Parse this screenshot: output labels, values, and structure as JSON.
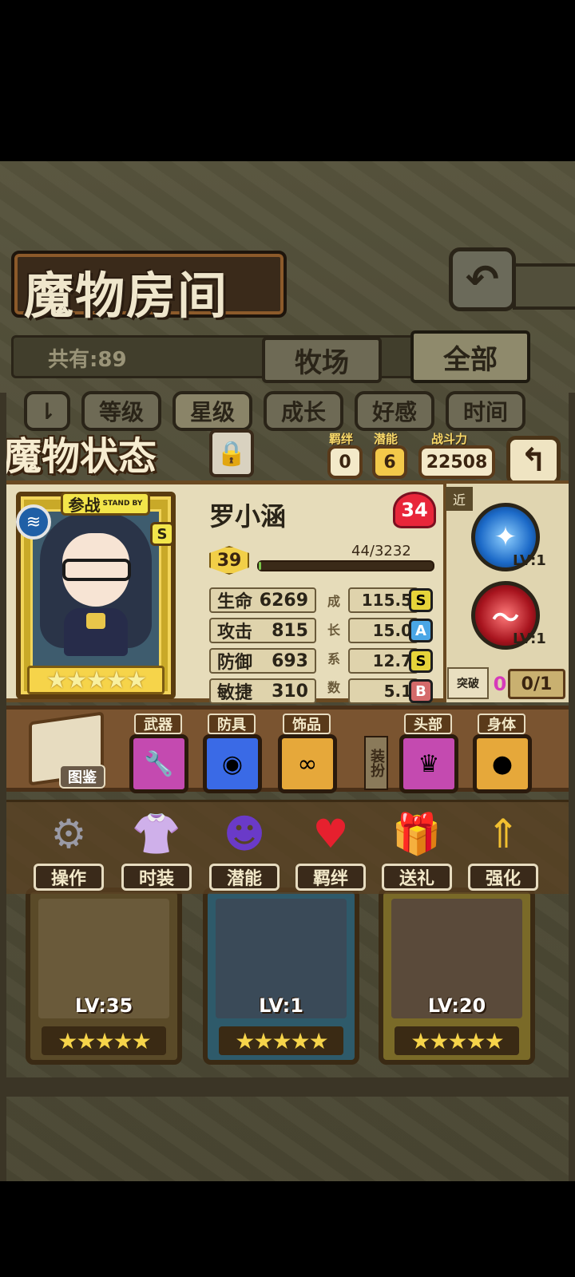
{
  "room": {
    "title": "魔物房间",
    "count_label": "共有:89",
    "back_icon": "back-arrow-icon",
    "tabs": [
      {
        "label": "牧场"
      },
      {
        "label": "全部"
      }
    ],
    "sort": [
      {
        "label": "等级"
      },
      {
        "label": "星级"
      },
      {
        "label": "成长"
      },
      {
        "label": "好感"
      },
      {
        "label": "时间"
      }
    ]
  },
  "status": {
    "title": "魔物状态",
    "bond_label": "羁绊",
    "bond_value": "0",
    "potential_label": "潜能",
    "potential_value": "6",
    "power_label": "战斗力",
    "power_value": "22508",
    "monster": {
      "badge": "参战",
      "badge_sub": "STAND BY",
      "rank": "S",
      "name": "罗小涵",
      "affinity": "34",
      "level": "39",
      "exp": "44/3232",
      "exp_fraction": 0.014,
      "star_count": 5
    },
    "stats": [
      {
        "label": "生命",
        "value": "6269",
        "growth": "115.5",
        "grade": "S"
      },
      {
        "label": "攻击",
        "value": "815",
        "growth": "15.0",
        "grade": "A"
      },
      {
        "label": "防御",
        "value": "693",
        "growth": "12.7",
        "grade": "S"
      },
      {
        "label": "敏捷",
        "value": "310",
        "growth": "5.1",
        "grade": "B"
      }
    ],
    "growth_vertical": [
      "成",
      "长",
      "系",
      "数"
    ],
    "skills": {
      "range_tag": "近",
      "items": [
        {
          "lv": "LV:1"
        },
        {
          "lv": "LV:1"
        }
      ],
      "break_label": "突破",
      "break_count": "0",
      "break_progress": "0/1"
    }
  },
  "equipment": {
    "book_label": "图鉴",
    "slots": [
      {
        "label": "武器"
      },
      {
        "label": "防具"
      },
      {
        "label": "饰品"
      },
      {
        "label": "头部"
      },
      {
        "label": "身体"
      }
    ],
    "dress_label": "装扮"
  },
  "actions": [
    {
      "label": "操作"
    },
    {
      "label": "时装"
    },
    {
      "label": "潜能"
    },
    {
      "label": "羁绊"
    },
    {
      "label": "送礼"
    },
    {
      "label": "强化"
    }
  ],
  "monsters": [
    {
      "lv": "LV:35",
      "stars": "★★★★★"
    },
    {
      "lv": "LV:1",
      "stars": "★★★★★"
    },
    {
      "lv": "LV:20",
      "stars": "★★★★★"
    }
  ],
  "colors": {
    "grade_S": "#e6d43a",
    "grade_A": "#4aa6e6",
    "grade_B": "#d46a6a",
    "skill_blue": "#1c6ac8",
    "skill_red": "#a8141e"
  }
}
